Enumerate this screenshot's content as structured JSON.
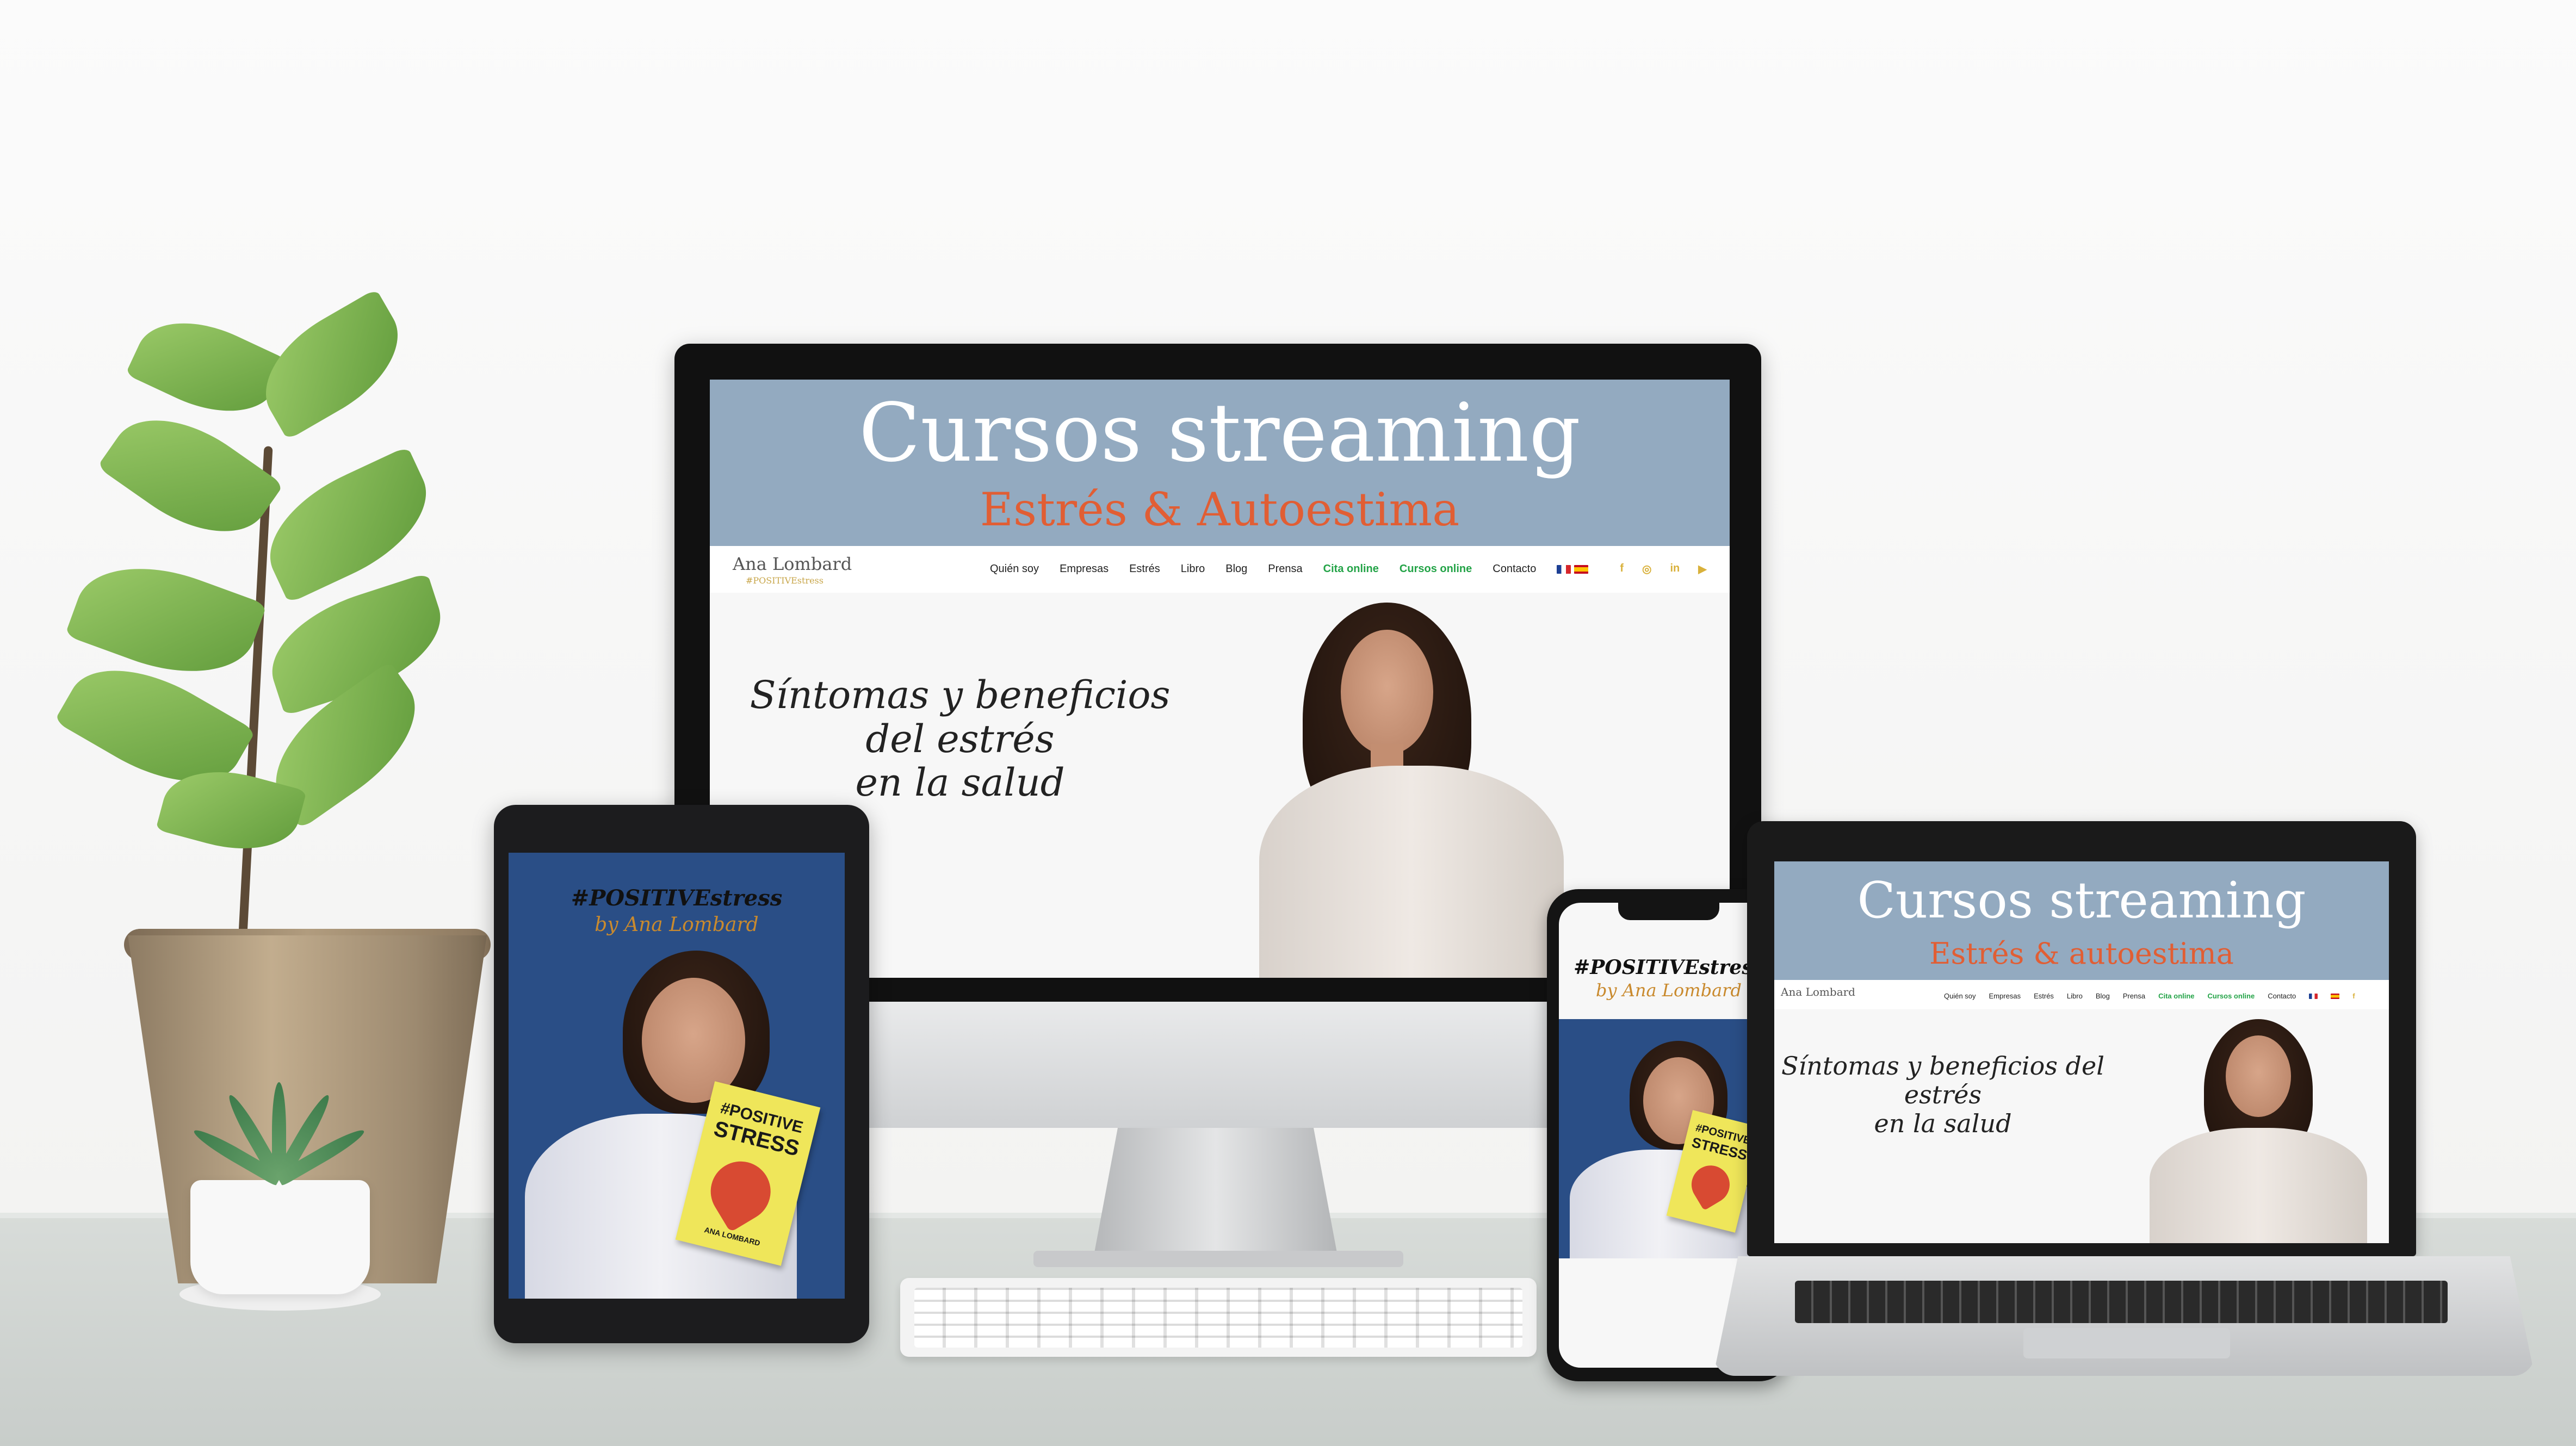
{
  "site": {
    "hero_title": "Cursos streaming",
    "hero_subtitle": "Estrés & Autoestima",
    "logo_name": "Ana Lombard",
    "logo_tagline": "#POSITIVEstress",
    "nav": [
      "Quién soy",
      "Empresas",
      "Estrés",
      "Libro",
      "Blog",
      "Prensa",
      "Cita online",
      "Cursos online",
      "Contacto"
    ],
    "headline_line1": "Síntomas y beneficios del estrés",
    "headline_line2": "en la salud"
  },
  "laptop_site": {
    "hero_title": "Cursos streaming",
    "hero_subtitle": "Estrés & autoestima"
  },
  "tablet": {
    "title": "#POSITIVEstress",
    "byline": "by Ana Lombard",
    "book_line1": "#POSITIVE",
    "book_line2": "STRESS",
    "book_author": "ANA LOMBARD"
  },
  "phone": {
    "title": "#POSITIVEstress",
    "byline": "by Ana Lombard",
    "book_line1": "#POSITIVE",
    "book_line2": "STRESS"
  },
  "icons": [
    "facebook-icon",
    "instagram-icon",
    "linkedin-icon",
    "youtube-icon",
    "flag-fr-icon",
    "flag-es-icon"
  ],
  "colors": {
    "hero_band": "#93aac0",
    "hero_subtitle": "#e15e34",
    "nav_highlight": "#23a347",
    "social": "#d9b13b",
    "tablet_bg": "#2a4e86",
    "book": "#efe65a"
  }
}
